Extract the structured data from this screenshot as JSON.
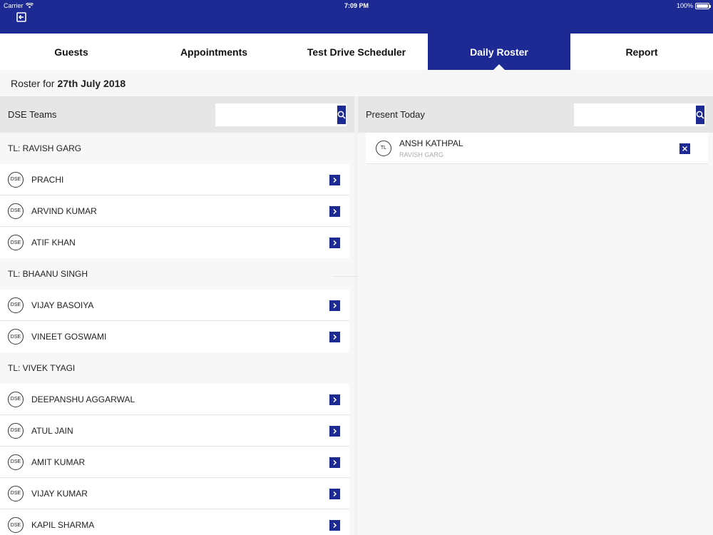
{
  "status_bar": {
    "carrier": "Carrier",
    "time": "7:09 PM",
    "battery": "100%",
    "battery_level": 1.0
  },
  "tabs": [
    {
      "label": "Guests",
      "active": false
    },
    {
      "label": "Appointments",
      "active": false
    },
    {
      "label": "Test Drive Scheduler",
      "active": false
    },
    {
      "label": "Daily Roster",
      "active": true
    },
    {
      "label": "Report",
      "active": false
    }
  ],
  "roster": {
    "prefix": "Roster for",
    "date": "27th July 2018"
  },
  "left_panel": {
    "title": "DSE Teams",
    "search_placeholder": "",
    "badge_label": "DSE",
    "groups": [
      {
        "header": "TL: RAVISH GARG",
        "members": [
          "PRACHI",
          "ARVIND KUMAR",
          "ATIF KHAN"
        ]
      },
      {
        "header": "TL: BHAANU SINGH",
        "members": [
          "VIJAY BASOIYA",
          "VINEET GOSWAMI"
        ]
      },
      {
        "header": "TL: VIVEK TYAGI",
        "members": [
          "DEEPANSHU AGGARWAL",
          "ATUL JAIN",
          "AMIT KUMAR",
          "VIJAY KUMAR",
          "KAPIL SHARMA"
        ]
      }
    ]
  },
  "right_panel": {
    "title": "Present Today",
    "search_placeholder": "",
    "present": [
      {
        "badge": "TL",
        "name": "ANSH KATHPAL",
        "sub": "RAVISH GARG"
      }
    ]
  },
  "colors": {
    "primary": "#1d2a93",
    "background": "#f7f7f7",
    "header_bg": "#e6e6e6"
  }
}
